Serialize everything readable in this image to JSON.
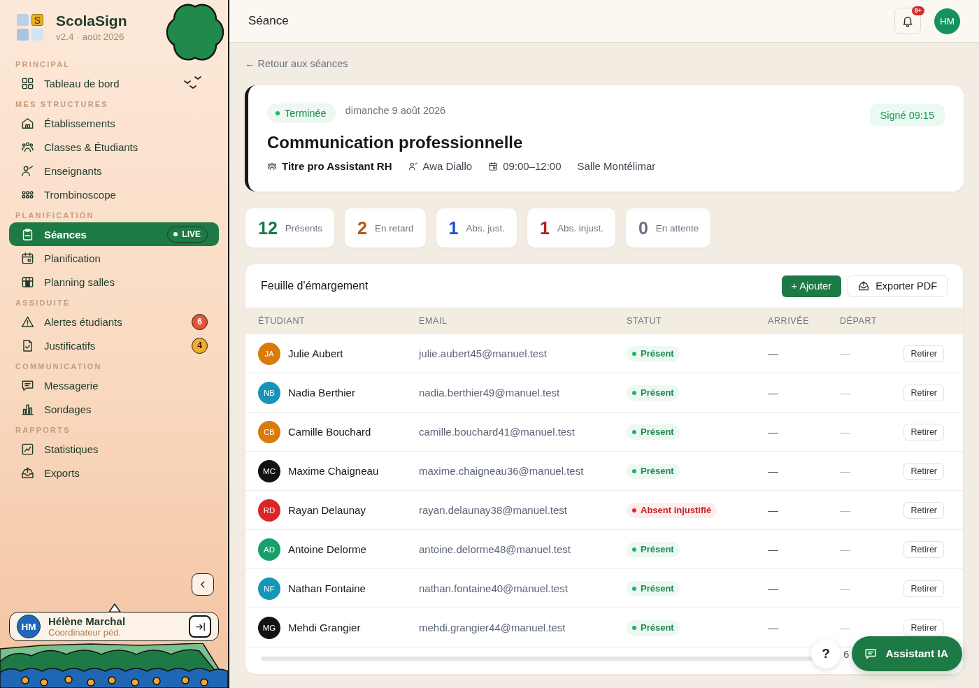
{
  "sidebar": {
    "logo_letter": "S",
    "app_name": "ScolaSign",
    "version": "v2.4 · août 2026",
    "sections": [
      {
        "title": "PRINCIPAL",
        "items": [
          {
            "label": "Tableau de bord",
            "selected": false
          }
        ]
      },
      {
        "title": "MES STRUCTURES",
        "items": [
          {
            "label": "Établissements",
            "selected": false
          },
          {
            "label": "Classes & Étudiants",
            "selected": false
          },
          {
            "label": "Enseignants",
            "selected": false
          },
          {
            "label": "Trombinoscope",
            "selected": false
          }
        ]
      },
      {
        "title": "PLANIFICATION",
        "items": [
          {
            "label": "Séances",
            "selected": true,
            "tag": "LIVE"
          },
          {
            "label": "Planification",
            "selected": false
          },
          {
            "label": "Planning salles",
            "selected": false
          }
        ]
      },
      {
        "title": "ASSIDUITÉ",
        "items": [
          {
            "label": "Alertes étudiants",
            "selected": false,
            "badge": {
              "text": "6",
              "color": "#e2553a"
            }
          },
          {
            "label": "Justificatifs",
            "selected": false,
            "badge": {
              "text": "4",
              "color": "#f0ad2e"
            }
          }
        ]
      },
      {
        "title": "COMMUNICATION",
        "items": [
          {
            "label": "Messagerie",
            "selected": false
          },
          {
            "label": "Sondages",
            "selected": false
          }
        ]
      },
      {
        "title": "RAPPORTS",
        "items": [
          {
            "label": "Statistiques",
            "selected": false
          },
          {
            "label": "Exports",
            "selected": false
          }
        ]
      }
    ],
    "user": {
      "initials": "HM",
      "name": "Hélène Marchal",
      "role": "Coordinateur péd."
    }
  },
  "header": {
    "title": "Séance",
    "notification_count": "9+",
    "avatar_initials": "HM"
  },
  "back_link": "← Retour aux séances",
  "session": {
    "status": {
      "label": "Terminée",
      "kind": "completed"
    },
    "date": "dimanche 9 août 2026",
    "signature": "Signé 09:15",
    "title": "Communication professionnelle",
    "group": "Titre pro Assistant RH",
    "teacher": "Awa Diallo",
    "time": "09:00–12:00",
    "room": "Salle Montélimar"
  },
  "stats": [
    {
      "value": "12",
      "label": "Présents",
      "color": "#177a4a"
    },
    {
      "value": "2",
      "label": "En retard",
      "color": "#b45a0e"
    },
    {
      "value": "1",
      "label": "Abs. just.",
      "color": "#1d4ed8"
    },
    {
      "value": "1",
      "label": "Abs. injust.",
      "color": "#b91c1c"
    },
    {
      "value": "0",
      "label": "En attente",
      "color": "#6b7280"
    }
  ],
  "sheet": {
    "title": "Feuille d'émargement",
    "buttons": [
      {
        "label": "+ Ajouter",
        "kind": "primary"
      },
      {
        "label": "Exporter PDF",
        "kind": "export"
      }
    ],
    "columns": [
      "ÉTUDIANT",
      "EMAIL",
      "STATUT",
      "ARRIVÉE",
      "DÉPART"
    ],
    "rows": [
      {
        "initials": "JA",
        "color": "#d97b0b",
        "name": "Julie Aubert",
        "email": "julie.aubert45@manuel.test",
        "status": {
          "label": "Présent",
          "kind": "present"
        },
        "arrival": "—",
        "departure": "—",
        "action": "Retirer"
      },
      {
        "initials": "NB",
        "color": "#1795b8",
        "name": "Nadia Berthier",
        "email": "nadia.berthier49@manuel.test",
        "status": {
          "label": "Présent",
          "kind": "present"
        },
        "arrival": "—",
        "departure": "—",
        "action": "Retirer"
      },
      {
        "initials": "CB",
        "color": "#d97b0b",
        "name": "Camille Bouchard",
        "email": "camille.bouchard41@manuel.test",
        "status": {
          "label": "Présent",
          "kind": "present"
        },
        "arrival": "—",
        "departure": "—",
        "action": "Retirer"
      },
      {
        "initials": "MC",
        "color": "#121212",
        "name": "Maxime Chaigneau",
        "email": "maxime.chaigneau36@manuel.test",
        "status": {
          "label": "Présent",
          "kind": "present"
        },
        "arrival": "—",
        "departure": "—",
        "action": "Retirer"
      },
      {
        "initials": "RD",
        "color": "#dc2626",
        "name": "Rayan Delaunay",
        "email": "rayan.delaunay38@manuel.test",
        "status": {
          "label": "Absent injustifié",
          "kind": "absent_unjustified"
        },
        "arrival": "—",
        "departure": "—",
        "action": "Retirer"
      },
      {
        "initials": "AD",
        "color": "#16a06a",
        "name": "Antoine Delorme",
        "email": "antoine.delorme48@manuel.test",
        "status": {
          "label": "Présent",
          "kind": "present"
        },
        "arrival": "—",
        "departure": "—",
        "action": "Retirer"
      },
      {
        "initials": "NF",
        "color": "#1795b8",
        "name": "Nathan Fontaine",
        "email": "nathan.fontaine40@manuel.test",
        "status": {
          "label": "Présent",
          "kind": "present"
        },
        "arrival": "—",
        "departure": "—",
        "action": "Retirer"
      },
      {
        "initials": "MG",
        "color": "#121212",
        "name": "Mehdi Grangier",
        "email": "mehdi.grangier44@manuel.test",
        "status": {
          "label": "Présent",
          "kind": "present"
        },
        "arrival": "—",
        "departure": "—",
        "action": "Retirer"
      }
    ]
  },
  "floating": {
    "help": "?",
    "partial_text": "6",
    "assistant": "Assistant IA"
  }
}
